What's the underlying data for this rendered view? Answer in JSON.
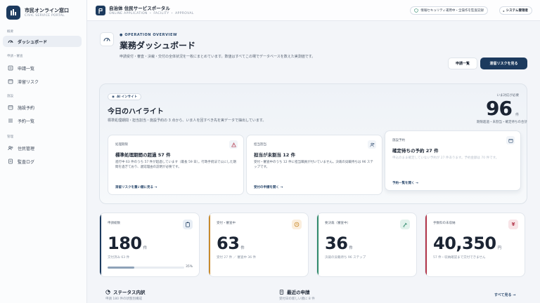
{
  "sidebar": {
    "title": "市民オンライン窓口",
    "subtitle": "CIVIC SERVICE PORTAL",
    "sections": [
      {
        "label": "概要",
        "items": [
          {
            "label": "ダッシュボード",
            "icon": "gauge-icon",
            "active": true
          }
        ]
      },
      {
        "label": "申請・審査",
        "items": [
          {
            "label": "申請一覧",
            "icon": "list-icon"
          },
          {
            "label": "滞留リスク",
            "icon": "clock-icon"
          }
        ]
      },
      {
        "label": "施設",
        "items": [
          {
            "label": "施設予約",
            "icon": "calendar-icon"
          },
          {
            "label": "予約一覧",
            "icon": "list-icon"
          }
        ]
      },
      {
        "label": "管理",
        "items": [
          {
            "label": "住民管理",
            "icon": "users-icon"
          },
          {
            "label": "監査ログ",
            "icon": "document-icon"
          }
        ]
      }
    ]
  },
  "topbar": {
    "title": "自治体 住民サービスポータル",
    "breadcrumb": "ONLINE APPLICATION ・ FACILITY ・ APPROVAL",
    "security_label": "情報セキュリティ運用中・全操作を監査記録",
    "admin_label": "システム管理者"
  },
  "header": {
    "eyebrow": "OPERATION OVERVIEW",
    "title": "業務ダッシュボード",
    "description": "申請受付・審査・決裁・交付の全体状況を一枚にまとめています。数値はすべてこの場でデータベースを数えた実測値です。",
    "btn_list": "申請一覧",
    "btn_risk": "滞留リスクを見る"
  },
  "highlight": {
    "badge": "AI インサイト",
    "title": "今日のハイライト",
    "description": "標準処理期間・担当割当・施設予約の 3 点から、いま人を回すべき先を実データで抽出しています。",
    "attention_label": "いま対応が必要",
    "attention_value": "96",
    "attention_unit": "件",
    "attention_note": "期限超過・未割当・確定待ちの合計",
    "cards": [
      {
        "tag": "処理期限",
        "title": "標準処理期間の超過 57 件",
        "body": "進行中 63 件のうち 57 件が超過しています（最長 59 日）。行政手続法で公にした期間を過ぎており、遅延理由の説明が必要です。",
        "link": "滞留リスクを重い順に見る →",
        "icon": "alert-icon"
      },
      {
        "tag": "担当割当",
        "title": "担当が未割当 12 件",
        "body": "受付・審査中のうち 12 件に担当職員が付いていません。決裁の貝載待ちは 96 ステップです。",
        "link": "受付の申請を開く →",
        "icon": "user-assign-icon"
      },
      {
        "tag": "施設予約",
        "title": "確定待ちの予約 27 件",
        "body": "申込のまま確定していない予約が 27 件あります。予約金額は 70 件です。",
        "link": "予約一覧を開く →",
        "icon": "calendar-icon"
      }
    ]
  },
  "kpis": [
    {
      "label": "申請総数",
      "value": "180",
      "unit": "件",
      "sub": "交付済み 63 件",
      "progress": 0.35,
      "progress_label": "35%",
      "icon": "clipboard-icon",
      "accent": "#1c3a5e",
      "icon_bg": "#e8eef5",
      "icon_color": "#1c3a5e"
    },
    {
      "label": "受付・審査中",
      "value": "63",
      "unit": "件",
      "sub": "受付 27 件 ／ 審査中 36 件",
      "icon": "clock-icon",
      "accent": "#c98a2b",
      "icon_bg": "#fbeedd",
      "icon_color": "#c98a2b"
    },
    {
      "label": "要決裁（審査中）",
      "value": "36",
      "unit": "件",
      "sub": "決裁の貝載待ち 96 ステップ",
      "icon": "stamp-icon",
      "accent": "#2f8a6b",
      "icon_bg": "#e2f2ec",
      "icon_color": "#2f8a6b"
    },
    {
      "label": "手数料の未収納",
      "value": "40,350",
      "unit": "円",
      "sub": "57 件・収納確認まで交付できません",
      "icon": "yen-icon",
      "accent": "#b2354a",
      "icon_bg": "#f8e4e7",
      "icon_color": "#b2354a"
    }
  ],
  "bottom": {
    "status_title": "ステータス内訳",
    "status_sub": "申請 180 件の状態別構成",
    "recent_title": "最近の申請",
    "recent_sub": "受付日の新しい順に 8 件",
    "see_all": "すべて見る →"
  }
}
